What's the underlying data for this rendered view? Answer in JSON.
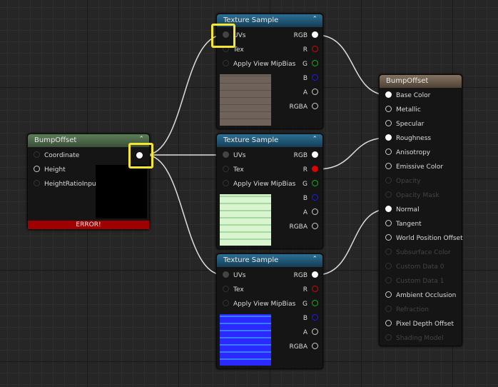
{
  "bump_node": {
    "title": "BumpOffset",
    "inputs": [
      "Coordinate",
      "Height",
      "HeightRatioInput"
    ],
    "error": "ERROR!",
    "header_color": "#4d6b4a"
  },
  "texture_nodes": [
    {
      "title": "Texture Sample",
      "inputs": [
        "UVs",
        "Tex",
        "Apply View MipBias"
      ],
      "outputs": [
        "RGB",
        "R",
        "G",
        "B",
        "A",
        "RGBA"
      ],
      "preview": "brick-diffuse"
    },
    {
      "title": "Texture Sample",
      "inputs": [
        "UVs",
        "Tex",
        "Apply View MipBias"
      ],
      "outputs": [
        "RGB",
        "R",
        "G",
        "B",
        "A",
        "RGBA"
      ],
      "preview": "brick-green"
    },
    {
      "title": "Texture Sample",
      "inputs": [
        "UVs",
        "Tex",
        "Apply View MipBias"
      ],
      "outputs": [
        "RGB",
        "R",
        "G",
        "B",
        "A",
        "RGBA"
      ],
      "preview": "brick-normal"
    }
  ],
  "material_node": {
    "title": "BumpOffset",
    "inputs": [
      {
        "label": "Base Color",
        "state": "connected"
      },
      {
        "label": "Metallic",
        "state": "enabled"
      },
      {
        "label": "Specular",
        "state": "enabled"
      },
      {
        "label": "Roughness",
        "state": "connected"
      },
      {
        "label": "Anisotropy",
        "state": "enabled"
      },
      {
        "label": "Emissive Color",
        "state": "enabled"
      },
      {
        "label": "Opacity",
        "state": "disabled"
      },
      {
        "label": "Opacity Mask",
        "state": "disabled"
      },
      {
        "label": "Normal",
        "state": "connected"
      },
      {
        "label": "Tangent",
        "state": "enabled"
      },
      {
        "label": "World Position Offset",
        "state": "enabled"
      },
      {
        "label": "Subsurface Color",
        "state": "disabled"
      },
      {
        "label": "Custom Data 0",
        "state": "disabled"
      },
      {
        "label": "Custom Data 1",
        "state": "disabled"
      },
      {
        "label": "Ambient Occlusion",
        "state": "enabled"
      },
      {
        "label": "Refraction",
        "state": "disabled"
      },
      {
        "label": "Pixel Depth Offset",
        "state": "enabled"
      },
      {
        "label": "Shading Model",
        "state": "disabled"
      }
    ]
  },
  "colors": {
    "texture_header": "#1f5a7a",
    "material_header": "#6e5e4c",
    "error": "#a00000",
    "highlight": "#f5e636",
    "R": "#e00000",
    "G": "#00c000",
    "B": "#1a1aff"
  }
}
